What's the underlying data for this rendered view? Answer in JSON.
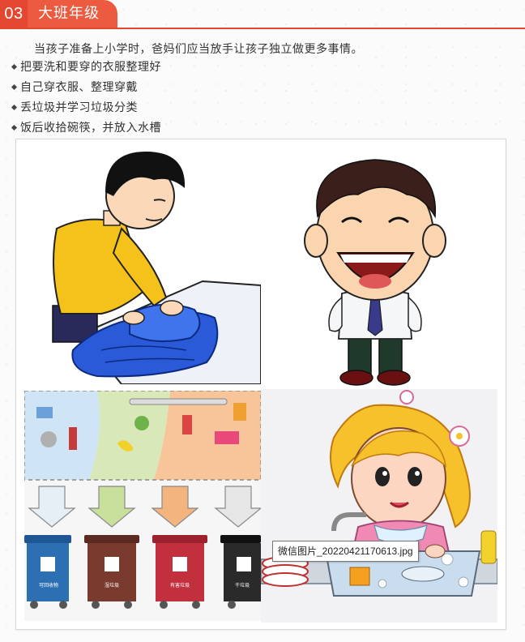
{
  "section": {
    "number": "03",
    "title": "大班年级"
  },
  "intro": "当孩子准备上小学时，爸妈们应当放手让孩子独立做更多事情。",
  "items": [
    "把要洗和要穿的衣服整理好",
    "自己穿衣服、整理穿戴",
    "丢垃圾并学习垃圾分类",
    "饭后收拾碗筷，并放入水槽"
  ],
  "illustration": {
    "panels": [
      {
        "name": "boy-folding-clothes"
      },
      {
        "name": "smiling-boy"
      },
      {
        "name": "garbage-sorting"
      },
      {
        "name": "girl-washing-dishes"
      }
    ],
    "bin_labels": [
      "可回收物",
      "湿垃圾",
      "有害垃圾",
      "干垃圾"
    ]
  },
  "tooltip": "微信图片_20220421170613.jpg",
  "colors": {
    "accent": "#e5462f",
    "accent_light": "#ec5a3f",
    "bin_recyclable": "#2c6fb3",
    "bin_wet": "#7a3a2e",
    "bin_hazardous": "#c2303e",
    "bin_dry": "#2a2a2a"
  }
}
